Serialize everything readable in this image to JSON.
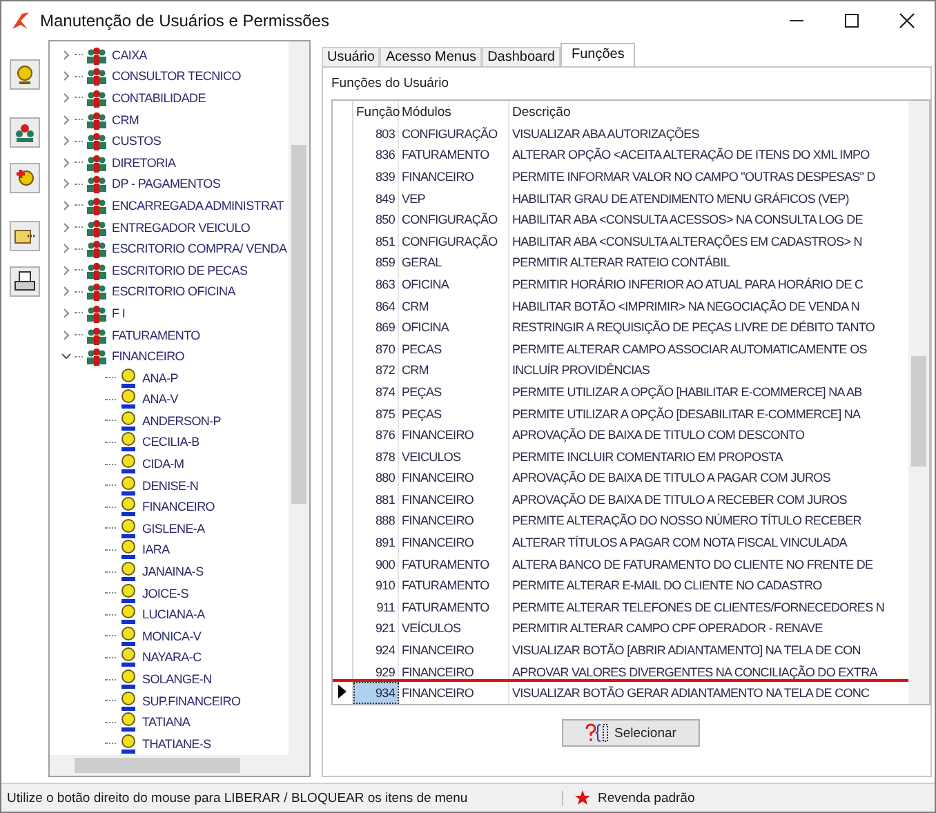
{
  "window": {
    "title": "Manutenção de Usuários e Permissões"
  },
  "tree": [
    {
      "label": "CAIXA",
      "expanded": false
    },
    {
      "label": "CONSULTOR TECNICO",
      "expanded": false
    },
    {
      "label": "CONTABILIDADE",
      "expanded": false
    },
    {
      "label": "CRM",
      "expanded": false
    },
    {
      "label": "CUSTOS",
      "expanded": false
    },
    {
      "label": "DIRETORIA",
      "expanded": false
    },
    {
      "label": "DP - PAGAMENTOS",
      "expanded": false
    },
    {
      "label": "ENCARREGADA ADMINISTRAT",
      "expanded": false
    },
    {
      "label": "ENTREGADOR VEICULO",
      "expanded": false
    },
    {
      "label": "ESCRITORIO COMPRA/ VENDA",
      "expanded": false
    },
    {
      "label": "ESCRITORIO DE PECAS",
      "expanded": false
    },
    {
      "label": "ESCRITORIO OFICINA",
      "expanded": false
    },
    {
      "label": "F I",
      "expanded": false
    },
    {
      "label": "FATURAMENTO",
      "expanded": false
    },
    {
      "label": "FINANCEIRO",
      "expanded": true,
      "children": [
        {
          "label": "ANA-P"
        },
        {
          "label": "ANA-V"
        },
        {
          "label": "ANDERSON-P"
        },
        {
          "label": "CECILIA-B"
        },
        {
          "label": "CIDA-M"
        },
        {
          "label": "DENISE-N"
        },
        {
          "label": "FINANCEIRO"
        },
        {
          "label": "GISLENE-A"
        },
        {
          "label": "IARA"
        },
        {
          "label": "JANAINA-S"
        },
        {
          "label": "JOICE-S"
        },
        {
          "label": "LUCIANA-A"
        },
        {
          "label": "MONICA-V"
        },
        {
          "label": "NAYARA-C"
        },
        {
          "label": "SOLANGE-N"
        },
        {
          "label": "SUP.FINANCEIRO"
        },
        {
          "label": "TATIANA"
        },
        {
          "label": "THATIANE-S"
        }
      ]
    }
  ],
  "tabs": [
    {
      "label": "Usuário",
      "selected": false
    },
    {
      "label": "Acesso Menus",
      "selected": false
    },
    {
      "label": "Dashboard",
      "selected": false
    },
    {
      "label": "Funções",
      "selected": true
    }
  ],
  "group_label": "Funções do Usuário",
  "table": {
    "columns": [
      "Função",
      "Módulos",
      "Descrição"
    ],
    "rows": [
      {
        "cells": [
          "803",
          "CONFIGURAÇÃO",
          "VISUALIZAR ABA AUTORIZAÇÕES"
        ],
        "selected": false,
        "highlighted": false
      },
      {
        "cells": [
          "836",
          "FATURAMENTO",
          "ALTERAR OPÇÃO <ACEITA ALTERAÇÃO DE ITENS DO XML IMPO"
        ],
        "selected": false,
        "highlighted": false
      },
      {
        "cells": [
          "839",
          "FINANCEIRO",
          "PERMITE INFORMAR VALOR NO CAMPO \"OUTRAS DESPESAS\" D"
        ],
        "selected": false,
        "highlighted": false
      },
      {
        "cells": [
          "849",
          "VEP",
          "HABILITAR GRAU DE ATENDIMENTO MENU GRÁFICOS (VEP)"
        ],
        "selected": false,
        "highlighted": false
      },
      {
        "cells": [
          "850",
          "CONFIGURAÇÃO",
          "HABILITAR ABA <CONSULTA ACESSOS> NA CONSULTA LOG DE"
        ],
        "selected": false,
        "highlighted": false
      },
      {
        "cells": [
          "851",
          "CONFIGURAÇÃO",
          "HABILITAR ABA <CONSULTA ALTERAÇÕES EM CADASTROS> N"
        ],
        "selected": false,
        "highlighted": false
      },
      {
        "cells": [
          "859",
          "GERAL",
          "PERMITIR ALTERAR RATEIO CONTÁBIL"
        ],
        "selected": false,
        "highlighted": false
      },
      {
        "cells": [
          "863",
          "OFICINA",
          "PERMITIR HORÁRIO INFERIOR AO ATUAL PARA HORÁRIO DE C"
        ],
        "selected": false,
        "highlighted": false
      },
      {
        "cells": [
          "864",
          "CRM",
          "HABILITAR BOTÃO <IMPRIMIR> NA NEGOCIAÇÃO DE VENDA N"
        ],
        "selected": false,
        "highlighted": false
      },
      {
        "cells": [
          "869",
          "OFICINA",
          "RESTRINGIR A REQUISIÇÃO DE PEÇAS LIVRE DE DÉBITO TANTO"
        ],
        "selected": false,
        "highlighted": false
      },
      {
        "cells": [
          "870",
          "PECAS",
          "PERMITE ALTERAR CAMPO ASSOCIAR AUTOMATICAMENTE OS"
        ],
        "selected": false,
        "highlighted": false
      },
      {
        "cells": [
          "872",
          "CRM",
          "INCLUÍR PROVIDÊNCIAS"
        ],
        "selected": false,
        "highlighted": false
      },
      {
        "cells": [
          "874",
          "PEÇAS",
          "PERMITE UTILIZAR A OPÇÃO [HABILITAR E-COMMERCE] NA AB"
        ],
        "selected": false,
        "highlighted": false
      },
      {
        "cells": [
          "875",
          "PEÇAS",
          "PERMITE UTILIZAR A OPÇÃO [DESABILITAR E-COMMERCE] NA"
        ],
        "selected": false,
        "highlighted": false
      },
      {
        "cells": [
          "876",
          "FINANCEIRO",
          "APROVAÇÃO DE BAIXA DE TITULO COM DESCONTO"
        ],
        "selected": false,
        "highlighted": false
      },
      {
        "cells": [
          "878",
          "VEICULOS",
          "PERMITE INCLUIR COMENTARIO EM PROPOSTA"
        ],
        "selected": false,
        "highlighted": false
      },
      {
        "cells": [
          "880",
          "FINANCEIRO",
          "APROVAÇÃO DE BAIXA DE TITULO A PAGAR COM JUROS"
        ],
        "selected": false,
        "highlighted": false
      },
      {
        "cells": [
          "881",
          "FINANCEIRO",
          "APROVAÇÃO DE BAIXA DE TITULO A RECEBER COM JUROS"
        ],
        "selected": false,
        "highlighted": false
      },
      {
        "cells": [
          "888",
          "FINANCEIRO",
          "PERMITE ALTERAÇÃO DO NOSSO NÚMERO TÍTULO RECEBER"
        ],
        "selected": false,
        "highlighted": false
      },
      {
        "cells": [
          "891",
          "FINANCEIRO",
          "ALTERAR TÍTULOS A PAGAR COM NOTA FISCAL VINCULADA"
        ],
        "selected": false,
        "highlighted": false
      },
      {
        "cells": [
          "900",
          "FATURAMENTO",
          "ALTERA BANCO DE FATURAMENTO DO CLIENTE NO FRENTE DE"
        ],
        "selected": false,
        "highlighted": false
      },
      {
        "cells": [
          "910",
          "FATURAMENTO",
          "PERMITE ALTERAR E-MAIL DO CLIENTE NO CADASTRO"
        ],
        "selected": false,
        "highlighted": false
      },
      {
        "cells": [
          "911",
          "FATURAMENTO",
          "PERMITE ALTERAR TELEFONES DE CLIENTES/FORNECEDORES N"
        ],
        "selected": false,
        "highlighted": false
      },
      {
        "cells": [
          "921",
          "VEÍCULOS",
          "PERMITIR ALTERAR CAMPO CPF OPERADOR - RENAVE"
        ],
        "selected": false,
        "highlighted": false
      },
      {
        "cells": [
          "924",
          "FINANCEIRO",
          "VISUALIZAR BOTÃO [ABRIR ADIANTAMENTO] NA TELA DE CON"
        ],
        "selected": false,
        "highlighted": false
      },
      {
        "cells": [
          "929",
          "FINANCEIRO",
          "APROVAR VALORES DIVERGENTES NA CONCILIAÇÃO DO EXTRA"
        ],
        "selected": false,
        "highlighted": false
      },
      {
        "cells": [
          "934",
          "FINANCEIRO",
          "VISUALIZAR BOTÃO GERAR ADIANTAMENTO NA TELA DE CONC"
        ],
        "selected": true,
        "highlighted": true
      }
    ]
  },
  "button": "Selecionar",
  "status_bar": {
    "hint": "Utilize o botão direito do mouse para LIBERAR / BLOQUEAR os itens de menu",
    "legend": "Revenda padrão"
  }
}
